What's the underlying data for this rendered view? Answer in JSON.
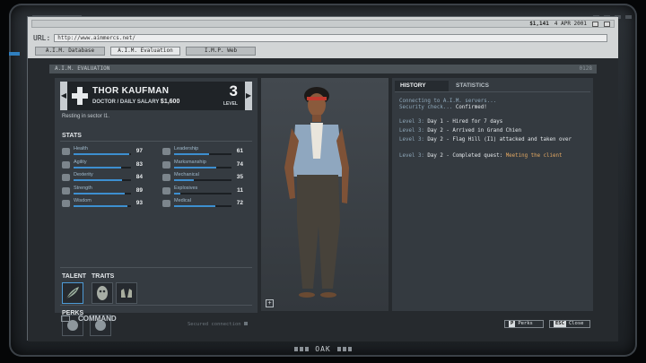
{
  "titlebar": {
    "money": "$1,141",
    "date": "4 APR 2001"
  },
  "browser": {
    "url_label": "URL:",
    "url": "http://www.aimmercs.net/",
    "tabs": [
      "A.I.M. Database",
      "A.I.M. Evaluation",
      "I.M.P. Web"
    ],
    "active_tab": 1
  },
  "page": {
    "header": "A.I.M. EVALUATION",
    "header_code": "0128"
  },
  "merc": {
    "name": "THOR KAUFMAN",
    "role": "DOCTOR / DAILY SALARY",
    "salary": "$1,600",
    "level": "3",
    "level_label": "LEVEL",
    "status": "Resting in sector I1."
  },
  "stats": {
    "heading": "STATS",
    "left": [
      {
        "label": "Health",
        "value": "97",
        "pct": 0.97,
        "icon": "heart-icon"
      },
      {
        "label": "Agility",
        "value": "83",
        "pct": 0.83,
        "icon": "agility-icon"
      },
      {
        "label": "Dexterity",
        "value": "84",
        "pct": 0.84,
        "icon": "hand-icon"
      },
      {
        "label": "Strength",
        "value": "89",
        "pct": 0.89,
        "icon": "fist-icon"
      },
      {
        "label": "Wisdom",
        "value": "93",
        "pct": 0.93,
        "icon": "brain-icon"
      }
    ],
    "right": [
      {
        "label": "Leadership",
        "value": "61",
        "pct": 0.61,
        "icon": "leadership-icon"
      },
      {
        "label": "Marksmanship",
        "value": "74",
        "pct": 0.74,
        "icon": "crosshair-icon"
      },
      {
        "label": "Mechanical",
        "value": "35",
        "pct": 0.35,
        "icon": "gear-icon"
      },
      {
        "label": "Explosives",
        "value": "11",
        "pct": 0.11,
        "icon": "explosive-icon"
      },
      {
        "label": "Medical",
        "value": "72",
        "pct": 0.72,
        "icon": "medkit-icon"
      }
    ]
  },
  "talent": {
    "heading": "TALENT",
    "traits_heading": "TRAITS",
    "perks_heading": "PERKS"
  },
  "command": {
    "label": "COMMAND"
  },
  "history": {
    "tab_history": "HISTORY",
    "tab_statistics": "STATISTICS",
    "connecting": "Connecting to A.I.M. servers...",
    "security": "Security check... ",
    "confirmed": "Confirmed!",
    "entries": [
      {
        "prefix": "Level 3: ",
        "text": "Day 1 - Hired for 7 days",
        "quest": ""
      },
      {
        "prefix": "Level 3: ",
        "text": "Day 2 - Arrived in Grand Chien",
        "quest": ""
      },
      {
        "prefix": "Level 3: ",
        "text": "Day 2 - Flag Hill (I1) attacked and taken over",
        "quest": ""
      },
      {
        "prefix": "Level 3: ",
        "text": "Day 2 - Completed quest: ",
        "quest": "Meeting the client"
      }
    ]
  },
  "footer": {
    "secured": "Secured connection",
    "perks_key": "P",
    "perks_label": "Perks",
    "close_key": "ESC",
    "close_label": "Close"
  },
  "bezel_label": "OAK"
}
